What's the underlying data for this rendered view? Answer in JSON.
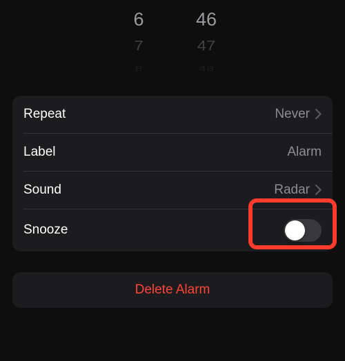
{
  "timePicker": {
    "hourCol": [
      "6",
      "7",
      "8"
    ],
    "minuteCol": [
      "46",
      "47",
      "48"
    ]
  },
  "rows": {
    "repeat": {
      "label": "Repeat",
      "value": "Never"
    },
    "label": {
      "label": "Label",
      "value": "Alarm"
    },
    "sound": {
      "label": "Sound",
      "value": "Radar"
    },
    "snooze": {
      "label": "Snooze"
    }
  },
  "snoozeOn": false,
  "delete": {
    "label": "Delete Alarm"
  },
  "colors": {
    "accentRed": "#ff453a",
    "highlight": "#ff3b30"
  }
}
